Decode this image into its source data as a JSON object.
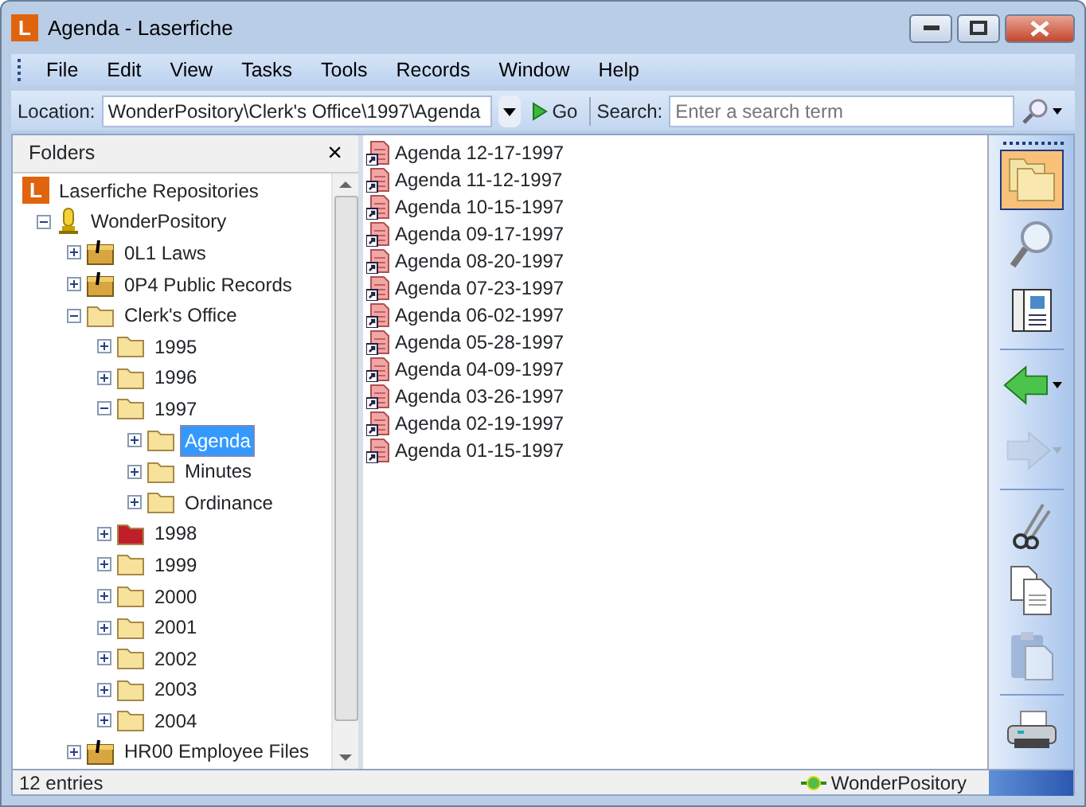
{
  "window": {
    "logo": "L",
    "title": "Agenda - Laserfiche"
  },
  "menu": [
    "File",
    "Edit",
    "View",
    "Tasks",
    "Tools",
    "Records",
    "Window",
    "Help"
  ],
  "address_bar": {
    "location_label": "Location:",
    "location_value": "WonderPository\\Clerk's Office\\1997\\Agenda",
    "go_label": "Go",
    "search_label": "Search:",
    "search_placeholder": "Enter a search term"
  },
  "folders_panel": {
    "title": "Folders",
    "close": "×",
    "tree": [
      {
        "label": "Laserfiche Repositories",
        "kind": "root",
        "logo": "L",
        "selected": false,
        "children": [
          {
            "label": "WonderPository",
            "kind": "repository",
            "expanded": true,
            "selected": false,
            "children": [
              {
                "label": "0L1 Laws",
                "kind": "cabinet",
                "expanded": false,
                "selected": false
              },
              {
                "label": "0P4 Public Records",
                "kind": "cabinet",
                "expanded": false,
                "selected": false
              },
              {
                "label": "Clerk's Office",
                "kind": "folder",
                "color": "#f6e29a",
                "expanded": true,
                "selected": false,
                "children": [
                  {
                    "label": "1995",
                    "kind": "folder",
                    "color": "#f6e29a",
                    "expanded": false,
                    "selected": false
                  },
                  {
                    "label": "1996",
                    "kind": "folder",
                    "color": "#f6e29a",
                    "expanded": false,
                    "selected": false
                  },
                  {
                    "label": "1997",
                    "kind": "folder",
                    "color": "#f6e29a",
                    "expanded": true,
                    "selected": false,
                    "children": [
                      {
                        "label": "Agenda",
                        "kind": "folder",
                        "color": "#f6e29a",
                        "expanded": false,
                        "selected": true
                      },
                      {
                        "label": "Minutes",
                        "kind": "folder",
                        "color": "#f6e29a",
                        "expanded": false,
                        "selected": false
                      },
                      {
                        "label": "Ordinance",
                        "kind": "folder",
                        "color": "#f6e29a",
                        "expanded": false,
                        "selected": false
                      }
                    ]
                  },
                  {
                    "label": "1998",
                    "kind": "folder",
                    "color": "#c01f2a",
                    "expanded": false,
                    "selected": false
                  },
                  {
                    "label": "1999",
                    "kind": "folder",
                    "color": "#f6e29a",
                    "expanded": false,
                    "selected": false
                  },
                  {
                    "label": "2000",
                    "kind": "folder",
                    "color": "#f6e29a",
                    "expanded": false,
                    "selected": false
                  },
                  {
                    "label": "2001",
                    "kind": "folder",
                    "color": "#f6e29a",
                    "expanded": false,
                    "selected": false
                  },
                  {
                    "label": "2002",
                    "kind": "folder",
                    "color": "#f6e29a",
                    "expanded": false,
                    "selected": false
                  },
                  {
                    "label": "2003",
                    "kind": "folder",
                    "color": "#f6e29a",
                    "expanded": false,
                    "selected": false
                  },
                  {
                    "label": "2004",
                    "kind": "folder",
                    "color": "#f6e29a",
                    "expanded": false,
                    "selected": false
                  }
                ]
              },
              {
                "label": "HR00 Employee Files",
                "kind": "cabinet",
                "expanded": false,
                "selected": false
              }
            ]
          }
        ]
      }
    ]
  },
  "entries": [
    "Agenda 12-17-1997",
    "Agenda 11-12-1997",
    "Agenda 10-15-1997",
    "Agenda 09-17-1997",
    "Agenda 08-20-1997",
    "Agenda 07-23-1997",
    "Agenda 06-02-1997",
    "Agenda 05-28-1997",
    "Agenda 04-09-1997",
    "Agenda 03-26-1997",
    "Agenda 02-19-1997",
    "Agenda 01-15-1997"
  ],
  "side_toolbar": [
    {
      "tools": [
        {
          "kind": "folders",
          "selected": true,
          "disabled": false
        },
        {
          "kind": "search",
          "selected": false,
          "disabled": false
        },
        {
          "kind": "preview",
          "selected": false,
          "disabled": false
        }
      ]
    },
    {
      "tools": [
        {
          "kind": "back",
          "selected": false,
          "disabled": false,
          "has_menu": true
        },
        {
          "kind": "forward",
          "selected": false,
          "disabled": true,
          "has_menu": true
        }
      ]
    },
    {
      "tools": [
        {
          "kind": "cut",
          "selected": false,
          "disabled": false
        },
        {
          "kind": "copy",
          "selected": false,
          "disabled": false
        },
        {
          "kind": "paste",
          "selected": false,
          "disabled": true
        }
      ]
    },
    {
      "tools": [
        {
          "kind": "print",
          "selected": false,
          "disabled": false
        }
      ]
    }
  ],
  "status_bar": {
    "count": "12 entries",
    "repository": "WonderPository"
  }
}
